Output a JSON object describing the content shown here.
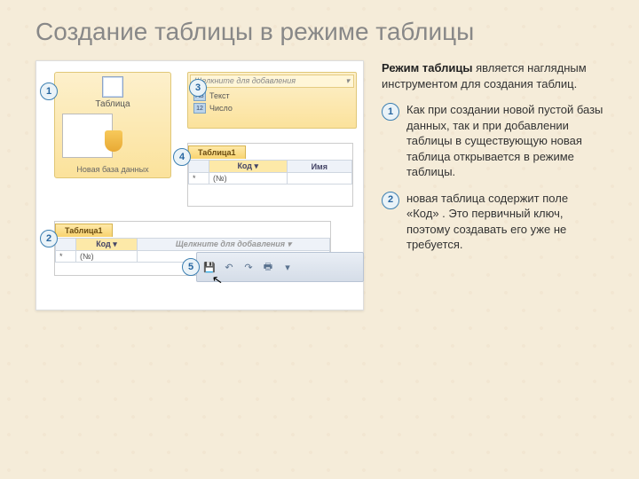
{
  "title": "Создание таблицы в режиме таблицы",
  "intro_bold": "Режим таблицы",
  "intro_rest": " является наглядным инструментом для создания таблиц.",
  "bullets": [
    "Как при создании новой пустой базы данных, так и при добавлении таблицы в существующую новая таблица открывается в режиме таблицы.",
    " новая таблица содержит поле «Код» . Это первичный ключ, поэтому создавать его уже не требуется."
  ],
  "panel1": {
    "icon_label": "Таблица",
    "caption": "Новая база данных"
  },
  "panel3": {
    "header": "Щелкните для добавления",
    "opt_text_ic": "АБ",
    "opt_text": "Текст",
    "opt_num_ic": "12",
    "opt_num": "Число"
  },
  "panel4": {
    "tab": "Таблица1",
    "col_id": "Код",
    "col_name": "Имя",
    "row_auto": "(№)"
  },
  "panel2": {
    "tab": "Таблица1",
    "col_id": "Код",
    "col_add": "Щелкните для добавления",
    "row_auto": "(№)"
  },
  "callouts": {
    "c1": "1",
    "c2": "2",
    "c3": "3",
    "c4": "4",
    "c5": "5"
  }
}
